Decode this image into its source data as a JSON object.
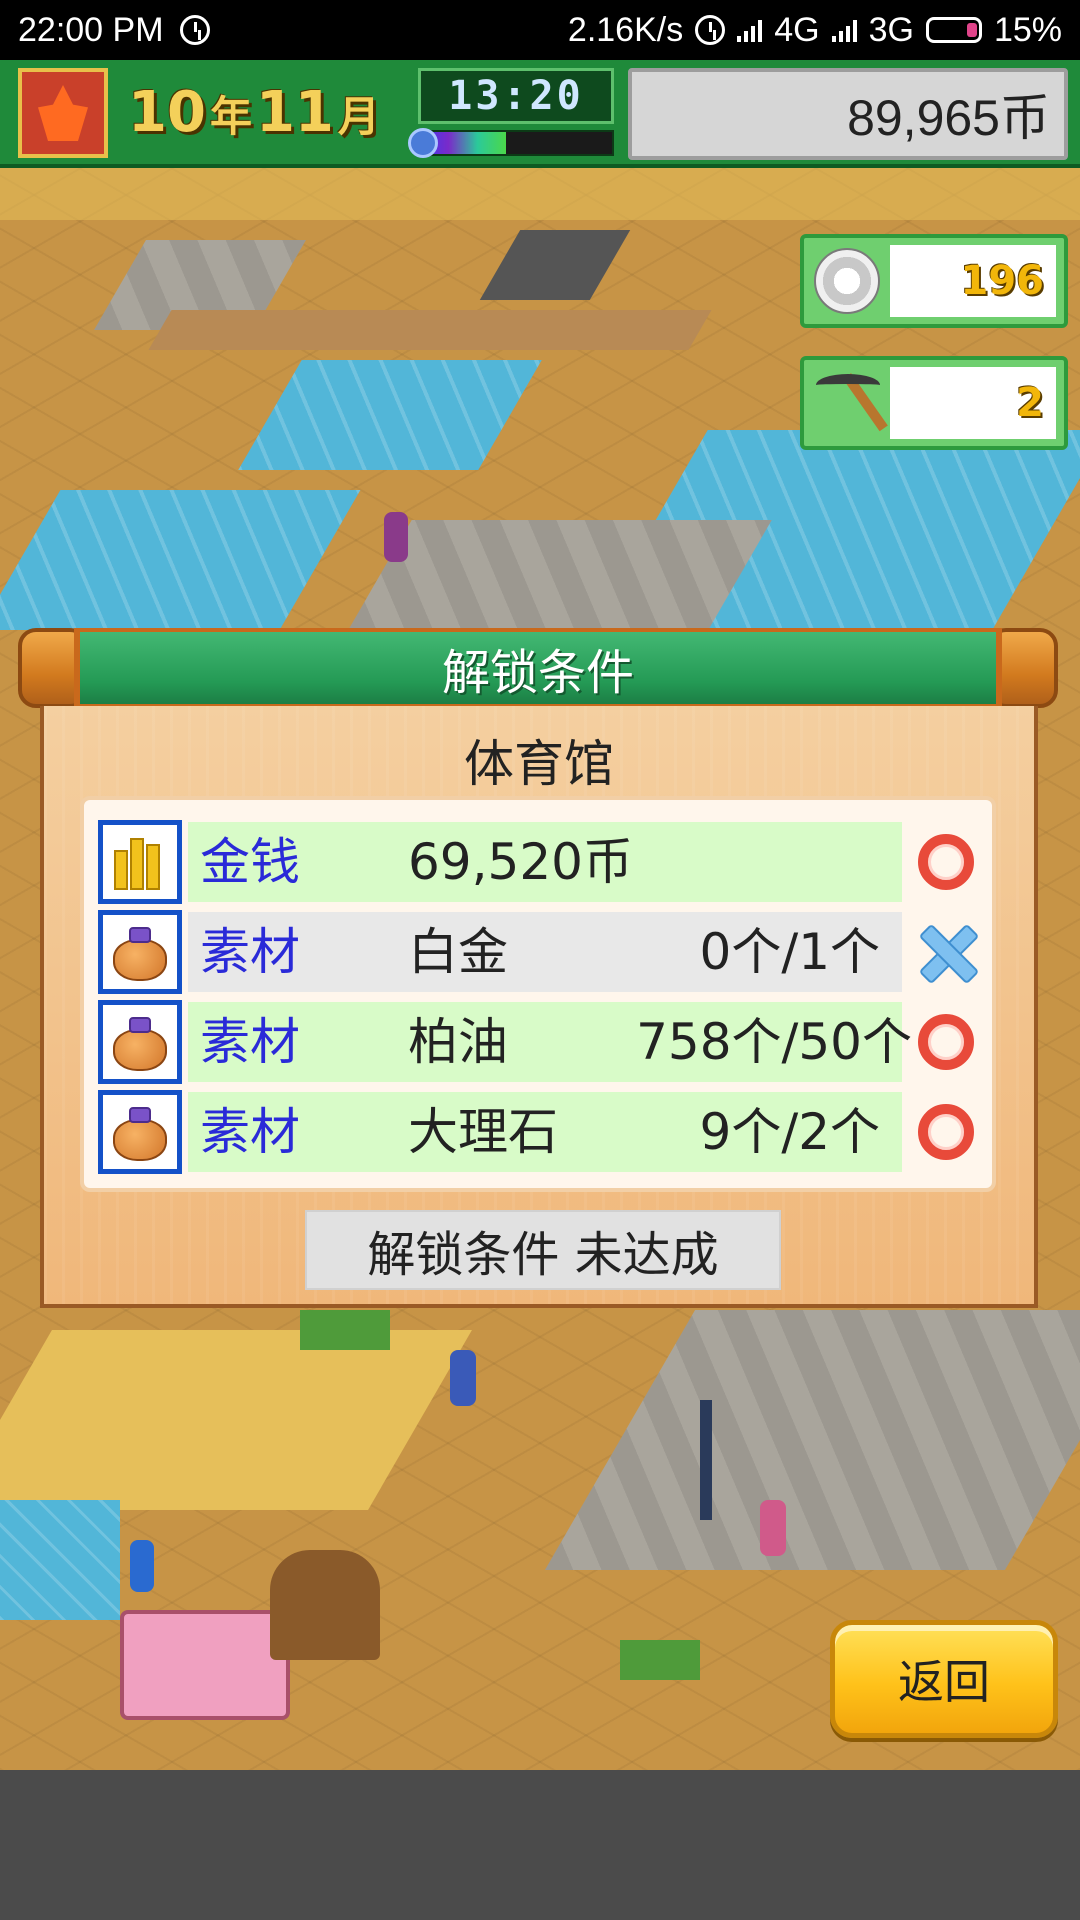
{
  "statusbar": {
    "time": "22:00 PM",
    "net_speed": "2.16K/s",
    "net1": "4G",
    "net2": "3G",
    "battery": "15%"
  },
  "hud": {
    "year": "10",
    "year_unit": "年",
    "month": "11",
    "month_unit": "月",
    "clock": "13:20",
    "money": "89,965币",
    "time_progress": 0.45
  },
  "resources": {
    "medals": "196",
    "pickaxes": "2"
  },
  "dialog": {
    "header": "解锁条件",
    "facility": "体育馆",
    "conditions": [
      {
        "kind": "金钱",
        "item": "69,520币",
        "qty": "",
        "met": true,
        "icon": "gold-bars-icon",
        "row_color": "#d8fbc8"
      },
      {
        "kind": "素材",
        "item": "白金",
        "qty": "0个/1个",
        "met": false,
        "icon": "material-bag-icon",
        "row_color": "#e8e8e8"
      },
      {
        "kind": "素材",
        "item": "柏油",
        "qty": "758个/50个",
        "met": true,
        "icon": "material-bag-icon",
        "row_color": "#d8fbc8"
      },
      {
        "kind": "素材",
        "item": "大理石",
        "qty": "9个/2个",
        "met": true,
        "icon": "material-bag-icon",
        "row_color": "#d8fbc8"
      }
    ],
    "status": "解锁条件 未达成"
  },
  "back_button": "返回",
  "colors": {
    "hud_green": "#1f8a3a",
    "met_mark": "#e84a3a",
    "unmet_mark": "#7ec0f0",
    "kind_text": "#2a2ad8"
  }
}
